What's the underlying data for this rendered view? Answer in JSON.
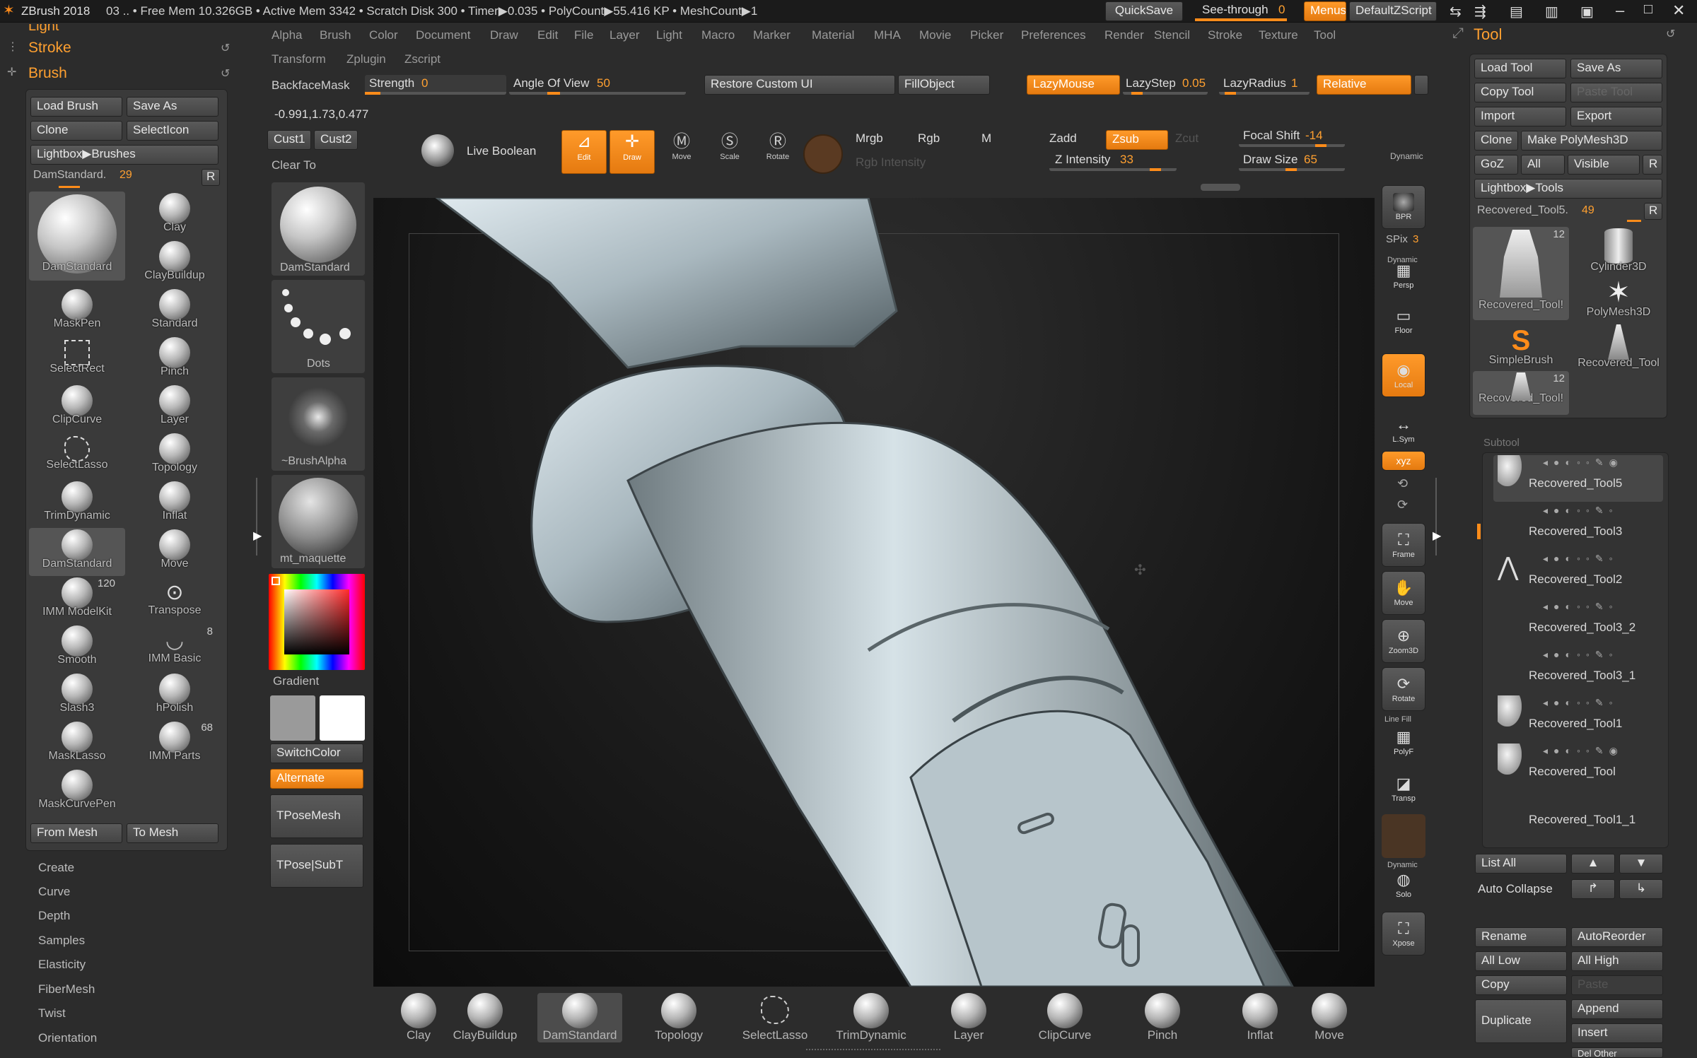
{
  "titlebar": {
    "app": "ZBrush 2018",
    "info": "03   .. • Free Mem 10.326GB • Active Mem 3342 • Scratch Disk 300 •  Timer▶0.035 • PolyCount▶55.416 KP  • MeshCount▶1",
    "quicksave": "QuickSave",
    "seethrough": "See-through",
    "seethrough_val": "0",
    "menus": "Menus",
    "defaultzscript": "DefaultZScript"
  },
  "menubar": {
    "row1": [
      "Alpha",
      "Brush",
      "Color",
      "Document",
      "Draw",
      "Edit",
      "File",
      "Layer",
      "Light",
      "Macro",
      "Marker",
      "Material",
      "MHA",
      "Movie",
      "Picker",
      "Preferences",
      "Render",
      "Stencil",
      "Stroke",
      "Texture",
      "Tool"
    ],
    "row2": [
      "Transform",
      "Zplugin",
      "Zscript"
    ]
  },
  "left_tray": {
    "light": "Light",
    "stroke": "Stroke",
    "brush": "Brush",
    "load_brush": "Load Brush",
    "save_as": "Save As",
    "clone": "Clone",
    "selecticon": "SelectIcon",
    "lightbox_brushes": "Lightbox▶Brushes",
    "current_brush": "DamStandard.",
    "current_brush_num": "29",
    "r_button": "R",
    "brushes": [
      {
        "name": "DamStandard",
        "count": ""
      },
      {
        "name": "Clay",
        "count": ""
      },
      {
        "name": "ClayBuildup",
        "count": ""
      },
      {
        "name": "MaskPen",
        "count": ""
      },
      {
        "name": "Standard",
        "count": ""
      },
      {
        "name": "SelectRect",
        "count": ""
      },
      {
        "name": "Pinch",
        "count": ""
      },
      {
        "name": "ClipCurve",
        "count": ""
      },
      {
        "name": "Layer",
        "count": ""
      },
      {
        "name": "SelectLasso",
        "count": ""
      },
      {
        "name": "Topology",
        "count": ""
      },
      {
        "name": "TrimDynamic",
        "count": ""
      },
      {
        "name": "Inflat",
        "count": ""
      },
      {
        "name": "DamStandard",
        "count": ""
      },
      {
        "name": "Move",
        "count": ""
      },
      {
        "name": "IMM ModelKit",
        "count": "120"
      },
      {
        "name": "Transpose",
        "count": ""
      },
      {
        "name": "Smooth",
        "count": ""
      },
      {
        "name": "IMM Basic",
        "count": "8"
      },
      {
        "name": "Slash3",
        "count": ""
      },
      {
        "name": "hPolish",
        "count": ""
      },
      {
        "name": "MaskLasso",
        "count": ""
      },
      {
        "name": "IMM Parts",
        "count": "68"
      },
      {
        "name": "MaskCurvePen",
        "count": ""
      }
    ],
    "from_mesh": "From Mesh",
    "to_mesh": "To Mesh",
    "sections": [
      "Create",
      "Curve",
      "Depth",
      "Samples",
      "Elasticity",
      "FiberMesh",
      "Twist",
      "Orientation"
    ]
  },
  "shelf": {
    "backfacemask": "BackfaceMask",
    "coords": "-0.991,1.73,0.477",
    "cust1": "Cust1",
    "cust2": "Cust2",
    "clear_to": "Clear To",
    "brush_label": "DamStandard",
    "stroke_label": "Dots",
    "alpha_label": "~BrushAlpha",
    "material_label": "mt_maquette",
    "gradient": "Gradient",
    "switchcolor": "SwitchColor",
    "alternate": "Alternate",
    "tposemesh": "TPoseMesh",
    "tposesubt": "TPose|SubT"
  },
  "top_shelf": {
    "strength_label": "Strength",
    "strength_val": "0",
    "angle_label": "Angle Of View",
    "angle_val": "50",
    "restore_custom_ui": "Restore Custom UI",
    "fillobject": "FillObject",
    "lazymouse": "LazyMouse",
    "lazystep_label": "LazyStep",
    "lazystep_val": "0.05",
    "lazyradius_label": "LazyRadius",
    "lazyradius_val": "1",
    "relative": "Relative",
    "live_boolean": "Live Boolean",
    "edit": "Edit",
    "draw": "Draw",
    "move": "Move",
    "scale": "Scale",
    "rotate": "Rotate",
    "mrgb": "Mrgb",
    "rgb": "Rgb",
    "m": "M",
    "rgb_intensity": "Rgb Intensity",
    "zadd": "Zadd",
    "zsub": "Zsub",
    "zcut": "Zcut",
    "z_intensity_label": "Z Intensity",
    "z_intensity_val": "33",
    "focal_shift_label": "Focal Shift",
    "focal_shift_val": "-14",
    "draw_size_label": "Draw Size",
    "draw_size_val": "65",
    "dynamic": "Dynamic"
  },
  "right_shelf": {
    "bpr": "BPR",
    "spix_label": "SPix",
    "spix_val": "3",
    "buttons": [
      {
        "icon": "▦",
        "label": "Persp"
      },
      {
        "icon": "▭",
        "label": "Floor"
      },
      {
        "icon": "◉",
        "label": "Local"
      },
      {
        "icon": "↔",
        "label": "L.Sym"
      },
      {
        "icon": "xyz",
        "label": "Xyz"
      },
      {
        "icon": "⛶",
        "label": "Frame"
      },
      {
        "icon": "✋",
        "label": "Move"
      },
      {
        "icon": "⊕",
        "label": "Zoom3D"
      },
      {
        "icon": "⟳",
        "label": "Rotate"
      },
      {
        "icon": "▦",
        "label": "PolyF"
      },
      {
        "icon": "◪",
        "label": "Transp"
      },
      {
        "icon": "◍",
        "label": "Solo"
      },
      {
        "icon": "⛶",
        "label": "Xpose"
      }
    ],
    "line_fill": "Line Fill",
    "dynamic": "Dynamic"
  },
  "tool_panel": {
    "title": "Tool",
    "load_tool": "Load Tool",
    "save_as": "Save As",
    "copy_tool": "Copy Tool",
    "paste_tool": "Paste Tool",
    "import": "Import",
    "export": "Export",
    "clone": "Clone",
    "make_polymesh": "Make PolyMesh3D",
    "goz": "GoZ",
    "all": "All",
    "visible": "Visible",
    "r": "R",
    "lightbox_tools": "Lightbox▶Tools",
    "current_tool": "Recovered_Tool5.",
    "current_tool_num": "49",
    "tools": [
      {
        "name": "Recovered_Tool!",
        "count": "12"
      },
      {
        "name": "Cylinder3D",
        "count": ""
      },
      {
        "name": "PolyMesh3D",
        "count": ""
      },
      {
        "name": "SimpleBrush",
        "count": ""
      },
      {
        "name": "Recovered_Tool",
        "count": ""
      },
      {
        "name": "Recovered_Tool!",
        "count": "12"
      }
    ],
    "subtool": "Subtool",
    "subtools": [
      "Recovered_Tool5",
      "Recovered_Tool3",
      "Recovered_Tool2",
      "Recovered_Tool3_2",
      "Recovered_Tool3_1",
      "Recovered_Tool1",
      "Recovered_Tool",
      "Recovered_Tool1_1"
    ],
    "list_all": "List All",
    "auto_collapse": "Auto Collapse",
    "rename": "Rename",
    "autoreorder": "AutoReorder",
    "all_low": "All Low",
    "all_high": "All High",
    "copy": "Copy",
    "paste": "Paste",
    "duplicate": "Duplicate",
    "append": "Append",
    "insert": "Insert",
    "del_other": "Del Other"
  },
  "bottom_brushes": [
    "Clay",
    "ClayBuildup",
    "DamStandard",
    "Topology",
    "SelectLasso",
    "TrimDynamic",
    "Layer",
    "ClipCurve",
    "Pinch",
    "Inflat",
    "Move"
  ],
  "colors": {
    "accent": "#ff8c1a",
    "panel": "#3a3a3a",
    "bg": "#2c2c2c"
  }
}
